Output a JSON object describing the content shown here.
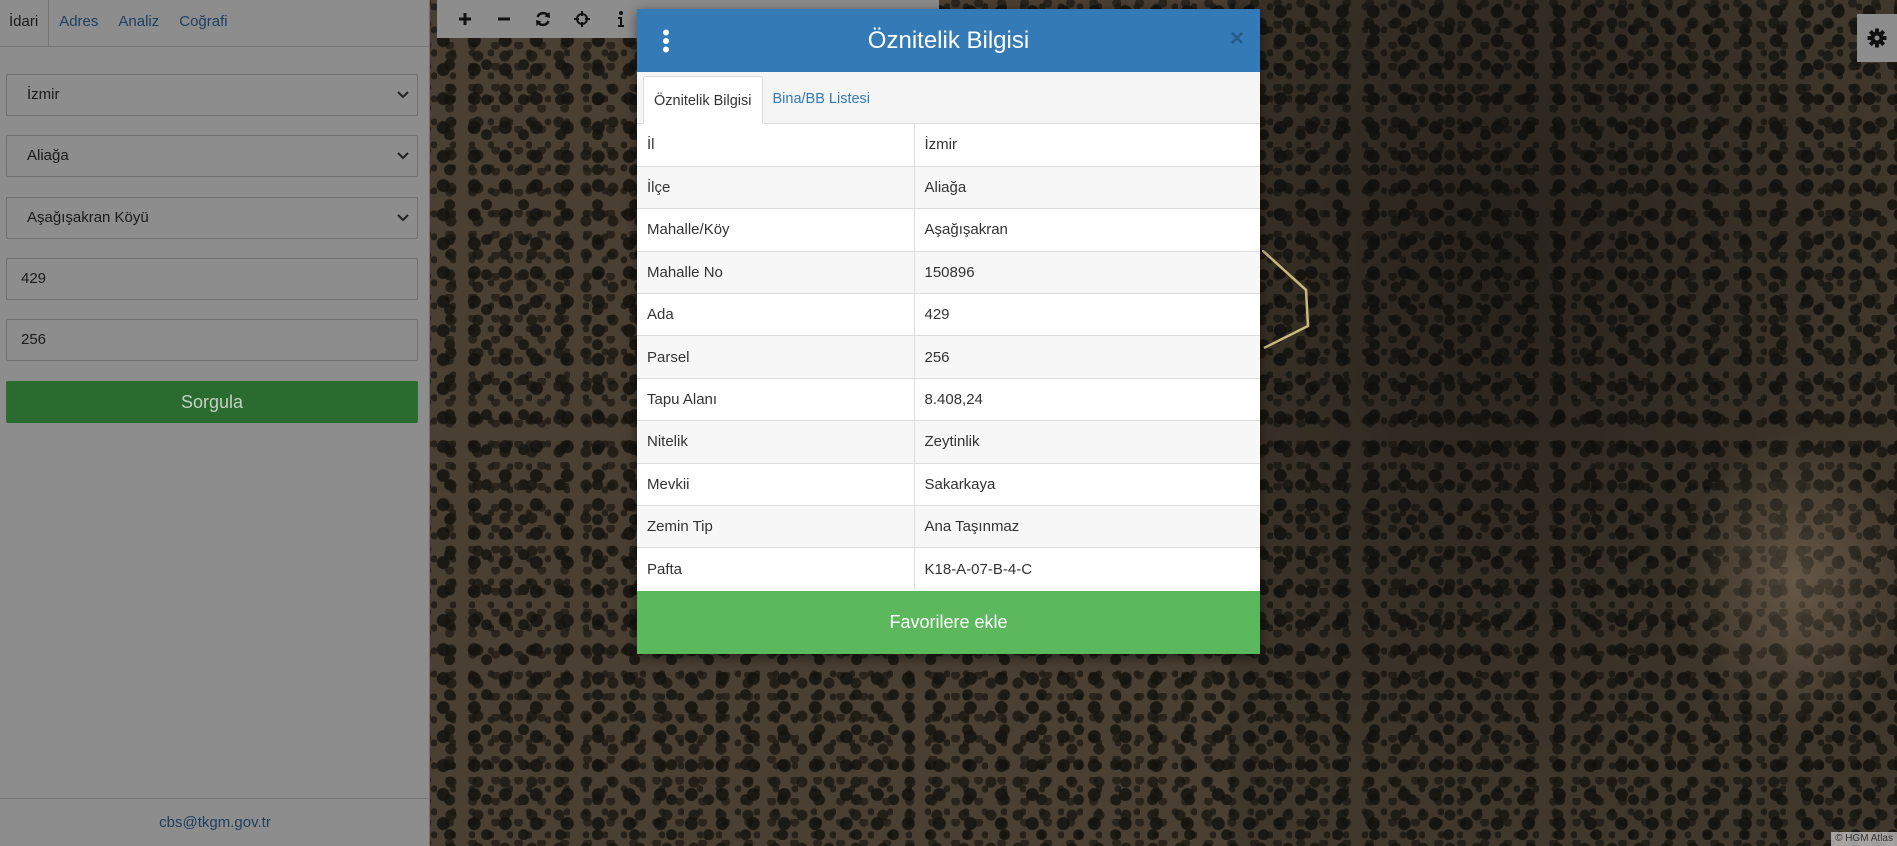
{
  "left_panel": {
    "tabs": [
      {
        "label": "İdari",
        "active": true
      },
      {
        "label": "Adres",
        "active": false
      },
      {
        "label": "Analiz",
        "active": false
      },
      {
        "label": "Coğrafi",
        "active": false
      }
    ],
    "fields": {
      "province": "İzmir",
      "district": "Aliağa",
      "neighborhood": "Aşağışakran Köyü",
      "block": "429",
      "parcel": "256"
    },
    "query_button": "Sorgula",
    "footer_email": "cbs@tkgm.gov.tr"
  },
  "toolbar": {
    "icons": [
      "zoom-in-icon",
      "zoom-out-icon",
      "refresh-icon",
      "locate-icon",
      "info-icon"
    ]
  },
  "modal": {
    "title": "Öznitelik Bilgisi",
    "close": "×",
    "tabs": [
      {
        "label": "Öznitelik Bilgisi",
        "active": true
      },
      {
        "label": "Bina/BB Listesi",
        "active": false
      }
    ],
    "rows": [
      {
        "key": "İl",
        "value": "İzmir"
      },
      {
        "key": "İlçe",
        "value": "Aliağa"
      },
      {
        "key": "Mahalle/Köy",
        "value": "Aşağışakran"
      },
      {
        "key": "Mahalle No",
        "value": "150896"
      },
      {
        "key": "Ada",
        "value": "429"
      },
      {
        "key": "Parsel",
        "value": "256"
      },
      {
        "key": "Tapu Alanı",
        "value": "8.408,24"
      },
      {
        "key": "Nitelik",
        "value": "Zeytinlik"
      },
      {
        "key": "Mevkii",
        "value": "Sakarkaya"
      },
      {
        "key": "Zemin Tip",
        "value": "Ana Taşınmaz"
      },
      {
        "key": "Pafta",
        "value": "K18-A-07-B-4-C"
      }
    ],
    "favorite_button": "Favorilere ekle"
  },
  "attribution": "© HGM Atlas",
  "colors": {
    "modal_header": "#337ab7",
    "favorite_button": "#5cb85c",
    "query_button": "#2a6c2f"
  }
}
